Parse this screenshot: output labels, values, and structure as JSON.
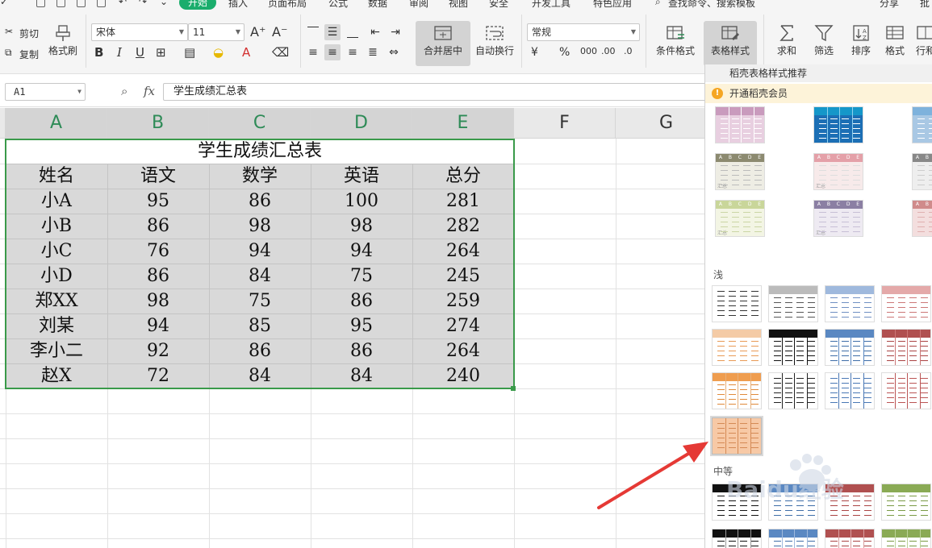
{
  "menu": {
    "tabs": [
      "开始",
      "插入",
      "页面布局",
      "公式",
      "数据",
      "审阅",
      "视图",
      "安全",
      "开发工具",
      "特色应用"
    ],
    "search": "查找命令、搜索模板",
    "share": "分享",
    "more": "批"
  },
  "ribbon": {
    "cut": "剪切",
    "copy": "复制",
    "format_painter": "格式刷",
    "font_name": "宋体",
    "font_size": "11",
    "bold": "B",
    "italic": "I",
    "underline": "U",
    "merge_center": "合并居中",
    "wrap_text": "自动换行",
    "number_format": "常规",
    "conditional_format": "条件格式",
    "table_style": "表格样式",
    "sum": "求和",
    "filter": "筛选",
    "sort": "排序",
    "format": "格式",
    "rows_cols": "行和"
  },
  "formula_bar": {
    "cell_ref": "A1",
    "fx": "fx",
    "content": "学生成绩汇总表"
  },
  "sheet": {
    "columns": [
      "A",
      "B",
      "C",
      "D",
      "E",
      "F",
      "G"
    ],
    "title": "学生成绩汇总表",
    "headers": [
      "姓名",
      "语文",
      "数学",
      "英语",
      "总分"
    ],
    "rows": [
      [
        "小A",
        "95",
        "86",
        "100",
        "281"
      ],
      [
        "小B",
        "86",
        "98",
        "98",
        "282"
      ],
      [
        "小C",
        "76",
        "94",
        "94",
        "264"
      ],
      [
        "小D",
        "86",
        "84",
        "75",
        "245"
      ],
      [
        "郑XX",
        "98",
        "75",
        "86",
        "259"
      ],
      [
        "刘某",
        "94",
        "85",
        "95",
        "274"
      ],
      [
        "李小二",
        "92",
        "86",
        "86",
        "264"
      ],
      [
        "赵X",
        "72",
        "84",
        "84",
        "240"
      ]
    ]
  },
  "panel": {
    "title": "稻壳表格样式推荐",
    "vip": "开通稻壳会员",
    "light": "浅",
    "medium": "中等",
    "thumb_letters": [
      "A",
      "B",
      "C",
      "D",
      "E"
    ],
    "thumb_sum": "汇总"
  },
  "watermark": "Baidu经验",
  "colors": {
    "selection": "#3a9a4a",
    "accent_green": "#1aad6c",
    "arrow_red": "#e53935"
  }
}
